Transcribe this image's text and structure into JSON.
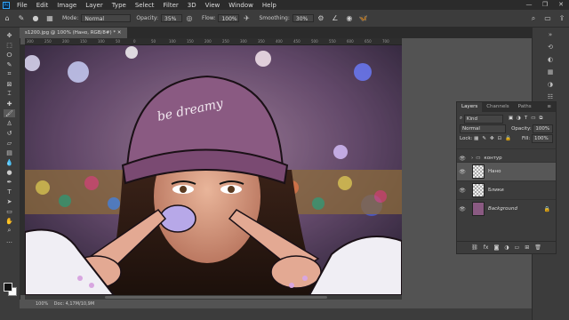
{
  "menubar": {
    "logo": "Ps",
    "items": [
      "File",
      "Edit",
      "Image",
      "Layer",
      "Type",
      "Select",
      "Filter",
      "3D",
      "View",
      "Window",
      "Help"
    ],
    "window_controls": [
      "—",
      "❐",
      "✕"
    ]
  },
  "options_bar": {
    "mode_label": "Mode:",
    "mode_value": "Normal",
    "opacity_label": "Opacity:",
    "opacity_value": "35%",
    "flow_label": "Flow:",
    "flow_value": "100%",
    "smoothing_label": "Smoothing:",
    "smoothing_value": "30%"
  },
  "document": {
    "tab_title": "s1200.jpg @ 100% (Нано, RGB/8#) *",
    "ruler_ticks": [
      "300",
      "250",
      "200",
      "150",
      "100",
      "50",
      "0",
      "50",
      "100",
      "150",
      "200",
      "250",
      "300",
      "350",
      "400",
      "450",
      "500",
      "550",
      "600",
      "650",
      "700"
    ],
    "status_zoom": "100%",
    "status_doc": "Doc: 4,17M/10,9M"
  },
  "layers_panel": {
    "tabs": [
      "Layers",
      "Channels",
      "Paths"
    ],
    "kind_label": "Kind",
    "blend_mode": "Normal",
    "opacity_label": "Opacity:",
    "opacity_value": "100%",
    "lock_label": "Lock:",
    "fill_label": "Fill:",
    "fill_value": "100%",
    "layers": [
      {
        "name": "контур",
        "type": "group",
        "visible": true
      },
      {
        "name": "Нано",
        "type": "layer",
        "visible": true,
        "selected": true
      },
      {
        "name": "Блики",
        "type": "layer",
        "visible": true
      },
      {
        "name": "Background",
        "type": "image",
        "visible": true,
        "locked": true
      }
    ]
  },
  "colors": {
    "accent": "#31a8ff",
    "panel_bg": "#3c3c3c",
    "workspace_bg": "#535353",
    "menubar_bg": "#2b2b2b",
    "beanie": "#8a5a82",
    "gum": "#b7a8e8"
  },
  "icons": {
    "tools": [
      "move-tool-icon",
      "marquee-tool-icon",
      "lasso-tool-icon",
      "quick-select-icon",
      "crop-tool-icon",
      "eyedropper-icon",
      "healing-brush-icon",
      "brush-tool-icon",
      "clone-stamp-icon",
      "history-brush-icon",
      "eraser-icon",
      "gradient-icon",
      "blur-icon",
      "dodge-icon",
      "pen-tool-icon",
      "type-tool-icon",
      "path-select-icon",
      "shape-tool-icon",
      "hand-tool-icon",
      "zoom-tool-icon"
    ]
  }
}
